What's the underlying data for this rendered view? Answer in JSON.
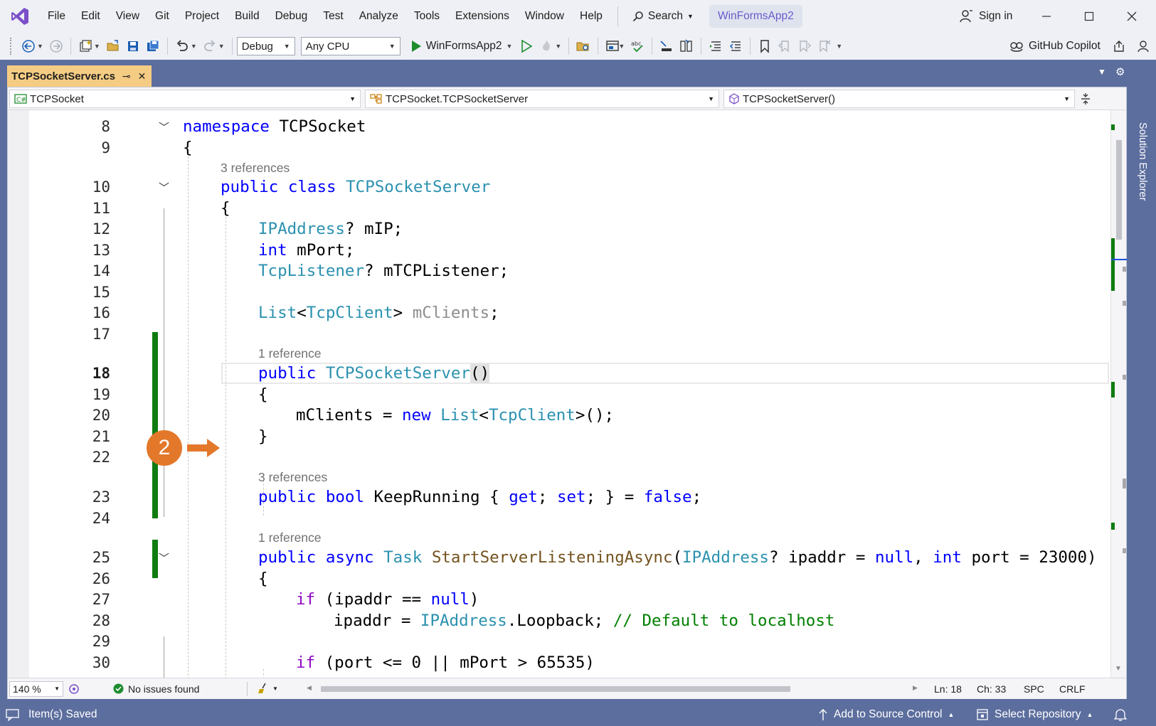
{
  "menu": {
    "items": [
      "File",
      "Edit",
      "View",
      "Git",
      "Project",
      "Build",
      "Debug",
      "Test",
      "Analyze",
      "Tools",
      "Extensions",
      "Window",
      "Help"
    ],
    "search_label": "Search",
    "solution_name": "WinFormsApp2",
    "sign_in": "Sign in"
  },
  "toolbar": {
    "configuration": "Debug",
    "platform": "Any CPU",
    "run_target": "WinFormsApp2",
    "copilot": "GitHub Copilot"
  },
  "tab": {
    "file_name": "TCPSocketServer.cs",
    "pin_glyph": "⊸",
    "close_glyph": "✕"
  },
  "side_panel": {
    "solution_explorer": "Solution Explorer"
  },
  "navbar": {
    "project": "TCPSocket",
    "type": "TCPSocket.TCPSocketServer",
    "member": "TCPSocketServer()"
  },
  "code": {
    "line_numbers": [
      "8",
      "9",
      "10",
      "11",
      "12",
      "13",
      "14",
      "15",
      "16",
      "17",
      "18",
      "19",
      "20",
      "21",
      "22",
      "23",
      "24",
      "25",
      "26",
      "27",
      "28",
      "29",
      "30"
    ],
    "codelens": {
      "class_refs": "3 references",
      "ctor_refs": "1 reference",
      "prop_refs": "3 references",
      "method_refs": "1 reference"
    },
    "tokens": {
      "namespace_kw": "namespace",
      "namespace_name": " TCPSocket",
      "open_brace": "{",
      "close_brace": "}",
      "public_kw": "public",
      "class_kw": " class",
      "class_name": " TCPSocketServer",
      "ipaddress_type": "IPAddress",
      "mip_field": "? mIP;",
      "int_kw": "int",
      "mport_field": " mPort;",
      "tcplistener_type": "TcpListener",
      "mtcplistener_field": "? mTCPListener;",
      "list_type": "List",
      "lt": "<",
      "tcpclient_type": "TcpClient",
      "gt": "> ",
      "mclients_dim": "mClients",
      "semicolon": ";",
      "ctor_name": " TCPSocketServer",
      "parens": "()",
      "mclients_assign": "mClients = ",
      "new_kw": "new",
      "space": " ",
      "list_end": ">();",
      "bool_kw": " bool",
      "keeprunning": " KeepRunning { ",
      "get_kw": "get",
      "semi_space": "; ",
      "set_kw": "set",
      "prop_end": "; } = ",
      "false_kw": "false",
      "async_kw": " async",
      "task_type": " Task",
      "method_name": " StartServerListeningAsync",
      "paren_open": "(",
      "ipaddr_param": "? ipaddr = ",
      "null_kw": "null",
      "comma": ", ",
      "port_param": " port = 23000)",
      "if_kw": "if",
      "if_cond1_a": " (ipaddr == ",
      "close_paren": ")",
      "ipaddr_assign": "ipaddr = ",
      "loopback": ".Loopback; ",
      "comment": "// Default to localhost",
      "if_cond2": " (port <= 0 || mPort > 65535)"
    }
  },
  "step_badge": "2",
  "editor_status": {
    "zoom": "140 %",
    "issues": "No issues found",
    "line": "Ln: 18",
    "char": "Ch: 33",
    "whitespace": "SPC",
    "line_ending": "CRLF"
  },
  "statusbar": {
    "saved": "Item(s) Saved",
    "add_source": "Add to Source Control",
    "select_repo": "Select Repository"
  },
  "colors": {
    "accent": "#5c6e9e",
    "tab_active": "#f5cc84",
    "badge": "#e3782b",
    "keyword": "#0000ff",
    "type": "#2b91af",
    "comment": "#008000",
    "change_bar": "#107c10"
  }
}
